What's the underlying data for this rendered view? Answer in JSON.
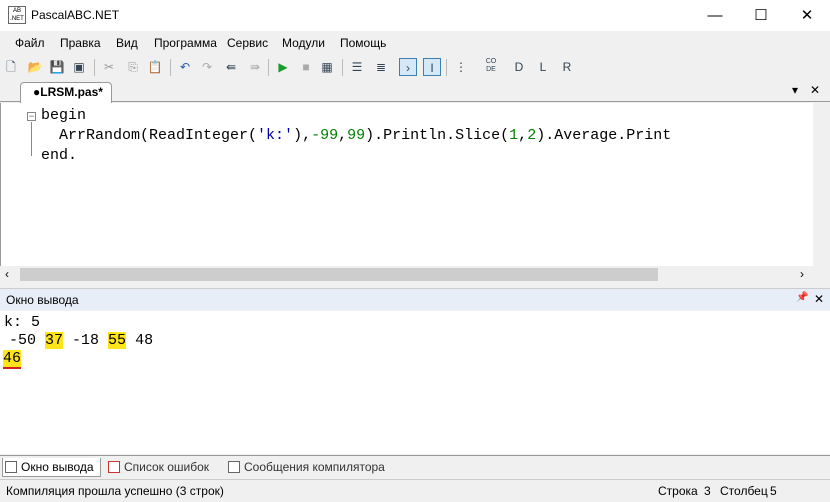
{
  "window": {
    "title": "PascalABC.NET",
    "minimize": "—",
    "maximize": "☐",
    "close": "✕"
  },
  "menu": [
    "Файл",
    "Правка",
    "Вид",
    "Программа",
    "Сервис",
    "Модули",
    "Помощь"
  ],
  "toolbar": {
    "icons": [
      "new-file",
      "open",
      "save",
      "save-all",
      "cut",
      "copy",
      "paste",
      "undo",
      "redo",
      "prev",
      "next",
      "run",
      "stop",
      "compile",
      "format",
      "goto",
      "console",
      "text",
      "outline",
      "code",
      "debug",
      "lib",
      "ref"
    ]
  },
  "editor": {
    "tab": "●LRSM.pas*",
    "tab_menu": "▾",
    "tab_close": "✕",
    "lines": {
      "l1": "begin",
      "l2_a": "  ArrRandom(ReadInteger(",
      "l2_str": "'k:'",
      "l2_b": "),",
      "l2_n1": "-99",
      "l2_c": ",",
      "l2_n2": "99",
      "l2_d": ").Println.Slice(",
      "l2_n3": "1",
      "l2_e": ",",
      "l2_n4": "2",
      "l2_f": ").Average.Print",
      "l3": "end."
    }
  },
  "output": {
    "title": "Окно вывода",
    "pin": "📌",
    "close": "✕",
    "line1": "k: 5",
    "line2": [
      " -50 ",
      "37",
      " -18 ",
      "55",
      " 48"
    ],
    "line3": "46"
  },
  "bottom_tabs": [
    "Окно вывода",
    "Список ошибок",
    "Сообщения компилятора"
  ],
  "status": {
    "message": "Компиляция прошла успешно (3 строк)",
    "row_label": "Строка",
    "row": "3",
    "col_label": "Столбец",
    "col": "5"
  }
}
